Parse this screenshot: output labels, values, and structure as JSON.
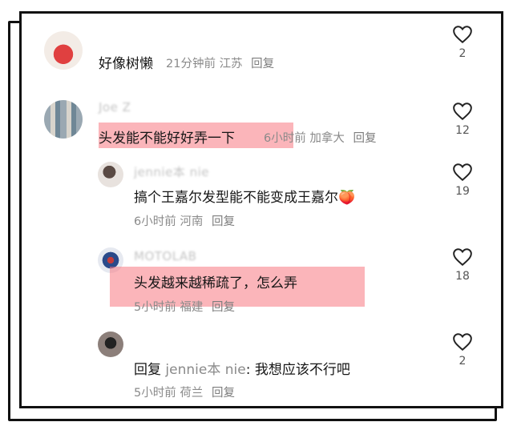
{
  "comments": [
    {
      "name": "",
      "text": "好像树懒",
      "time": "21分钟前",
      "region": "江苏",
      "reply": "回复",
      "likes": "2"
    },
    {
      "name": "Joe Z",
      "text": "头发能不能好好弄一下",
      "time": "6小时前",
      "region": "加拿大",
      "reply": "回复",
      "likes": "12"
    },
    {
      "name": "jennie本 nie",
      "text": "搞个王嘉尔发型能不能变成王嘉尔🍑",
      "time": "6小时前",
      "region": "河南",
      "reply": "回复",
      "likes": "19"
    },
    {
      "name": "MOTOLAB",
      "text": "头发越来越稀疏了，怎么弄",
      "time": "5小时前",
      "region": "福建",
      "reply": "回复",
      "likes": "18"
    },
    {
      "name": "",
      "text_prefix": "回复",
      "mention": "jennie本 nie",
      "text_suffix": ": 我想应该不行吧",
      "time": "5小时前",
      "region": "荷兰",
      "reply": "回复",
      "likes": "2"
    }
  ],
  "colors": {
    "highlight": "#f7838c",
    "meta": "#8a8a8a",
    "frame": "#111111"
  }
}
